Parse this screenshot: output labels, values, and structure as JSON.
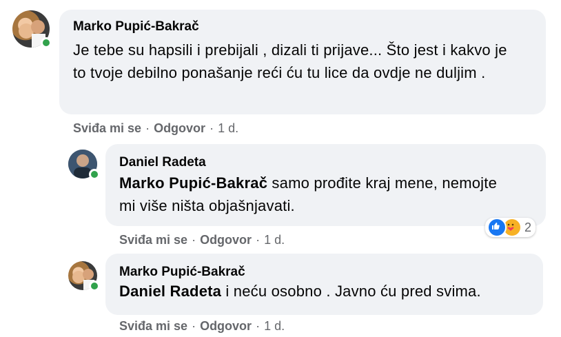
{
  "comments": [
    {
      "author": "Marko Pupić-Bakrač",
      "text": "Je tebe su hapsili i prebijali , dizali ti prijave... Što jest i kakvo je to tvoje debilno ponašanje reći ću tu lice da ovdje ne duljim .",
      "actions": {
        "like": "Sviđa mi se",
        "reply": "Odgovor",
        "time": "1 d."
      }
    },
    {
      "author": "Daniel Radeta",
      "mention": "Marko Pupić-Bakrač",
      "text": " samo prođite kraj mene, nemojte mi više ništa objašnjavati.",
      "actions": {
        "like": "Sviđa mi se",
        "reply": "Odgovor",
        "time": "1 d."
      },
      "reactions": {
        "icons": [
          "like-icon",
          "care-icon"
        ],
        "count": "2"
      }
    },
    {
      "author": "Marko Pupić-Bakrač",
      "mention": "Daniel Radeta",
      "text": " i neću osobno . Javno ću pred svima.",
      "actions": {
        "like": "Sviđa mi se",
        "reply": "Odgovor",
        "time": "1 d."
      }
    }
  ],
  "separator": "·",
  "colors": {
    "bubble": "#f0f2f5",
    "online": "#31a24c",
    "like": "#1877f2",
    "meta": "#65676b"
  }
}
